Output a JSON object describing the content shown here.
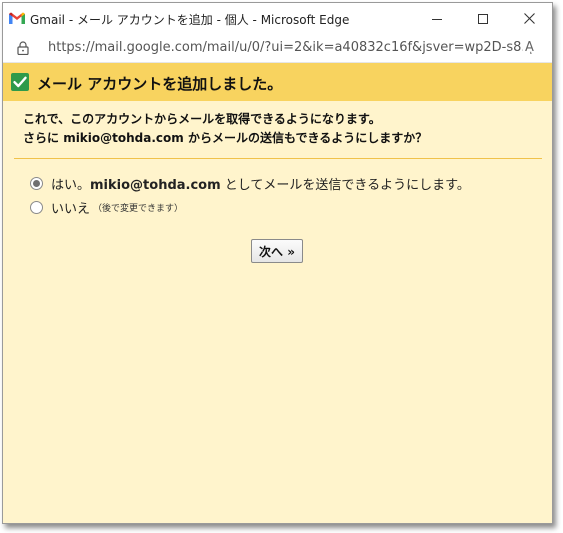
{
  "window": {
    "title": "Gmail - メール アカウントを追加 - 個人 - Microsoft Edge",
    "url": "https://mail.google.com/mail/u/0/?ui=2&ik=a40832c16f&jsver=wp2D-s8...",
    "read_aloud_label": "Aͅ"
  },
  "header": {
    "title": "メール アカウントを追加しました。"
  },
  "description": {
    "line1": "これで、このアカウントからメールを取得できるようになります。",
    "line2_prefix": "さらに ",
    "line2_email": "mikio@tohda.com",
    "line2_suffix": " からメールの送信もできるようにしますか？"
  },
  "options": {
    "yes_prefix": "はい。",
    "yes_email": "mikio@tohda.com",
    "yes_suffix": " としてメールを送信できるようにします。",
    "no_label": "いいえ",
    "no_note": "（後で変更できます）",
    "selected": "yes"
  },
  "next_button": {
    "label": "次へ »"
  },
  "colors": {
    "banner": "#f8d35f",
    "background": "#fff4cc",
    "divider": "#f0c24a",
    "check": "#2f9a4a"
  }
}
